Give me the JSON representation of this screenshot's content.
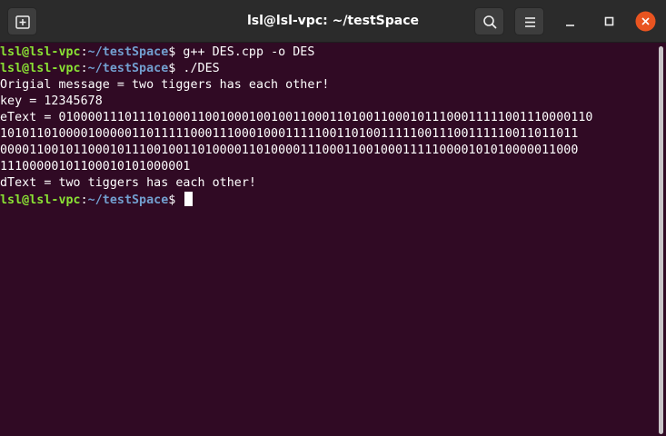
{
  "window": {
    "title": "lsl@lsl-vpc: ~/testSpace",
    "icons": {
      "new_tab": "new-tab-icon",
      "search": "search-icon",
      "menu": "hamburger-menu-icon",
      "minimize": "minimize-icon",
      "maximize": "maximize-icon",
      "close": "close-icon"
    },
    "colors": {
      "background": "#300a24",
      "titlebar": "#2b2b2b",
      "prompt_user": "#8ae234",
      "prompt_path": "#729fcf",
      "close_button": "#e95420",
      "text": "#ffffff"
    }
  },
  "terminal": {
    "prompt_user": "lsl@lsl-vpc",
    "prompt_sep": ":",
    "prompt_path": "~/testSpace",
    "prompt_symbol": "$ ",
    "command1": "g++ DES.cpp -o DES",
    "command2": "./DES",
    "output": {
      "original": "Origial message = two tiggers has each other!",
      "key": "key = 12345678",
      "etext_1": "eText = 0100001110111010001100100010010011000110100110001011100011111001110000110",
      "etext_2": "1010110100001000001101111100011100010001111100110100111110011100111110011011011",
      "etext_3": "0000110010110001011100100110100001101000011100011001000111110000101010000011000",
      "etext_4": "11100000101100010101000001",
      "dtext": "dText = two tiggers has each other!"
    }
  }
}
